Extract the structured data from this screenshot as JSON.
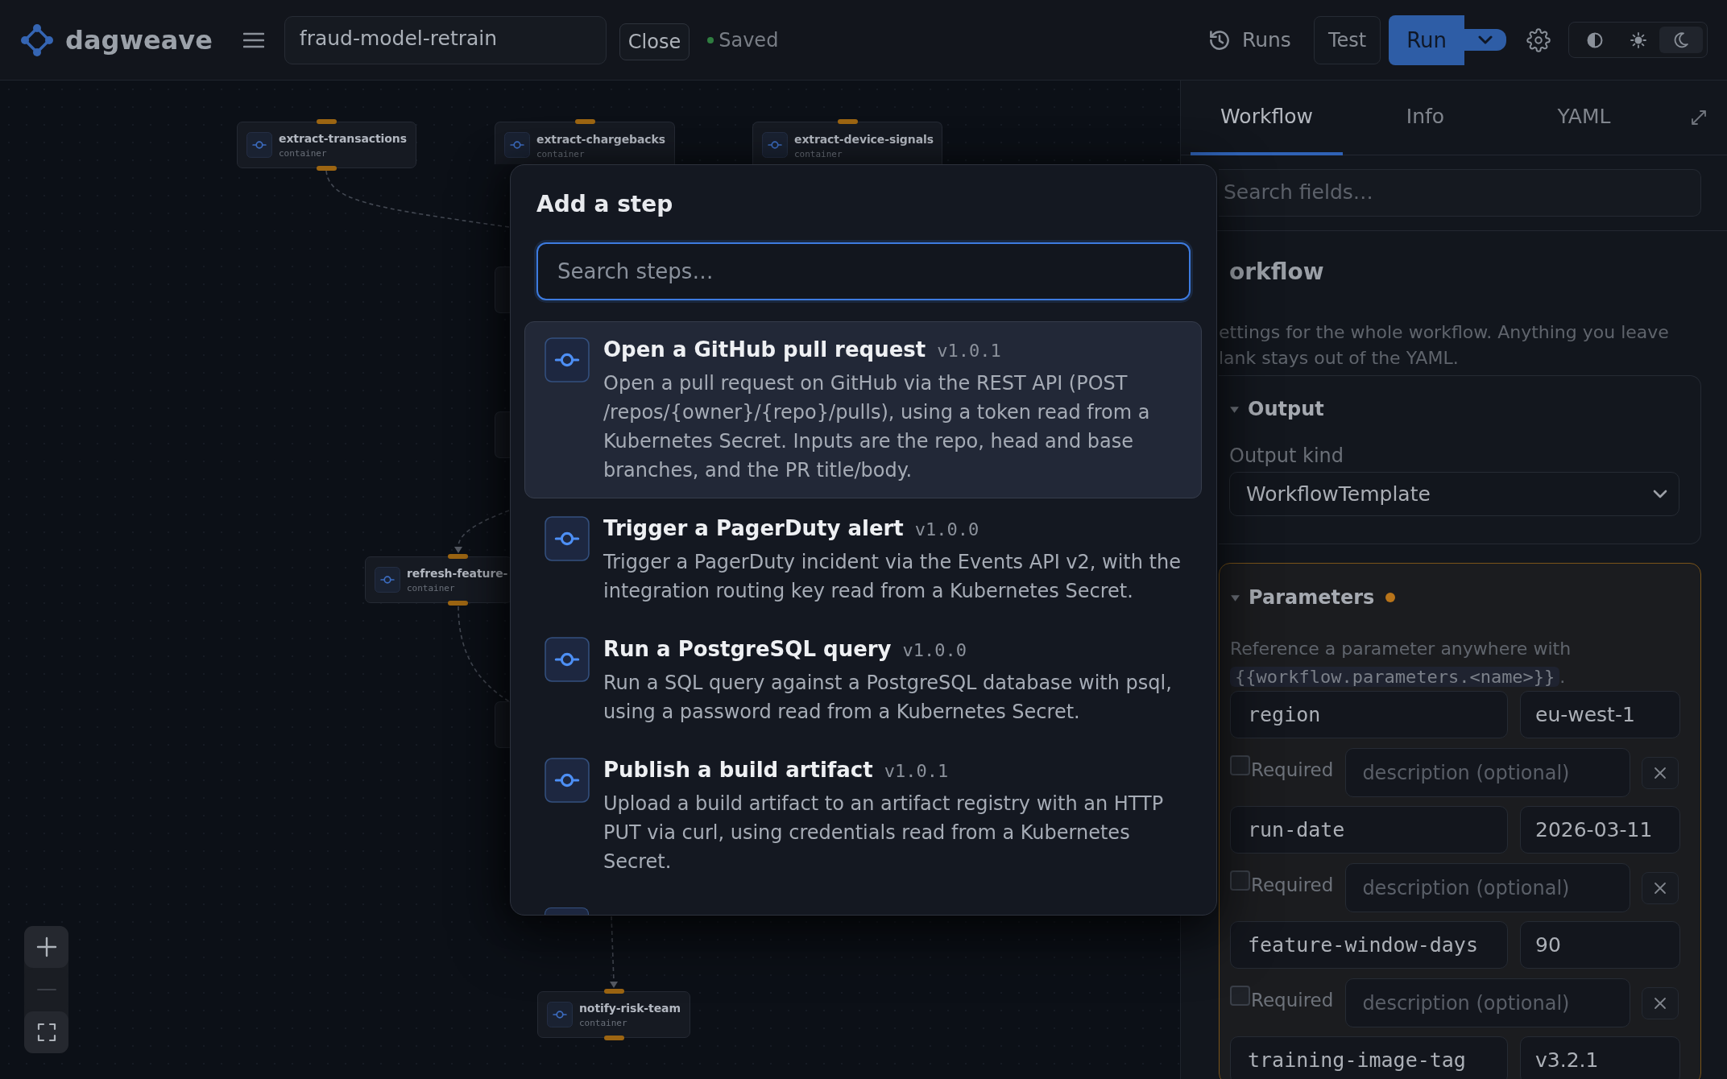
{
  "app": {
    "name": "dagweave"
  },
  "topbar": {
    "workflow_name": "fraud-model-retrain",
    "close_label": "Close",
    "status": {
      "label": "Saved",
      "saved": true
    },
    "runs_label": "Runs",
    "test_label": "Test",
    "run_label": "Run",
    "theme_options": [
      {
        "kind": "contrast",
        "selected": false
      },
      {
        "kind": "light",
        "selected": false
      },
      {
        "kind": "dark",
        "selected": true
      }
    ]
  },
  "canvas": {
    "nodes": [
      {
        "kind": "card",
        "name": "extract-transactions",
        "type": "container"
      },
      {
        "kind": "card",
        "name": "extract-chargebacks",
        "type": "container"
      },
      {
        "kind": "card",
        "name": "extract-device-signals",
        "type": "container"
      },
      {
        "kind": "covered"
      },
      {
        "kind": "covered"
      },
      {
        "kind": "card",
        "name": "refresh-feature-",
        "type": "container"
      },
      {
        "kind": "covered"
      },
      {
        "kind": "card",
        "name": "notify-risk-team",
        "type": "container"
      }
    ],
    "zoom_controls": [
      {
        "kind": "zoom-in",
        "disabled": false
      },
      {
        "kind": "zoom-out",
        "disabled": true
      },
      {
        "kind": "fit",
        "disabled": false
      }
    ]
  },
  "add_step_dialog": {
    "title": "Add a step",
    "search": {
      "placeholder": "Search steps…"
    },
    "steps": [
      {
        "title": "Open a GitHub pull request",
        "version": "v1.0.1",
        "description": "Open a pull request on GitHub via the REST API (POST /repos/{owner}/{repo}/pulls), using a token read from a Kubernetes Secret. Inputs are the repo, head and base branches, and the PR title/body.",
        "selected": true
      },
      {
        "title": "Trigger a PagerDuty alert",
        "version": "v1.0.0",
        "description": "Trigger a PagerDuty incident via the Events API v2, with the integration routing key read from a Kubernetes Secret.",
        "selected": false
      },
      {
        "title": "Run a PostgreSQL query",
        "version": "v1.0.0",
        "description": "Run a SQL query against a PostgreSQL database with psql, using a password read from a Kubernetes Secret.",
        "selected": false
      },
      {
        "title": "Publish a build artifact",
        "version": "v1.0.1",
        "description": "Upload a build artifact to an artifact registry with an HTTP PUT via curl, using credentials read from a Kubernetes Secret.",
        "selected": false
      }
    ],
    "more_below": true
  },
  "panel": {
    "tabs": [
      {
        "label": "Workflow",
        "selected": true
      },
      {
        "label": "Info",
        "selected": false
      },
      {
        "label": "YAML",
        "selected": false
      }
    ],
    "search": {
      "placeholder": "Search fields…"
    },
    "heading": "orkflow",
    "description": "ettings for the whole workflow. Anything you leave lank stays out of the YAML.",
    "sections": [
      {
        "kind": "output",
        "title": "Output",
        "expanded": true,
        "field_label": "Output kind",
        "field_value": "WorkflowTemplate"
      },
      {
        "kind": "parameters",
        "title": "Parameters",
        "expanded": true,
        "modified": true,
        "help_before": "Reference a parameter anywhere with",
        "help_code": "{{workflow.parameters.<name>}}",
        "help_after": ".",
        "parameters": [
          {
            "name": "region",
            "value": "eu-west-1",
            "required": false,
            "required_label": "Required",
            "description": {
              "placeholder": "description (optional)"
            }
          },
          {
            "name": "run-date",
            "value": "2026-03-11",
            "required": false,
            "required_label": "Required",
            "description": {
              "placeholder": "description (optional)"
            }
          },
          {
            "name": "feature-window-days",
            "value": "90",
            "required": false,
            "required_label": "Required",
            "description": {
              "placeholder": "description (optional)"
            }
          },
          {
            "name": "training-image-tag",
            "value": "v3.2.1"
          }
        ]
      }
    ]
  }
}
